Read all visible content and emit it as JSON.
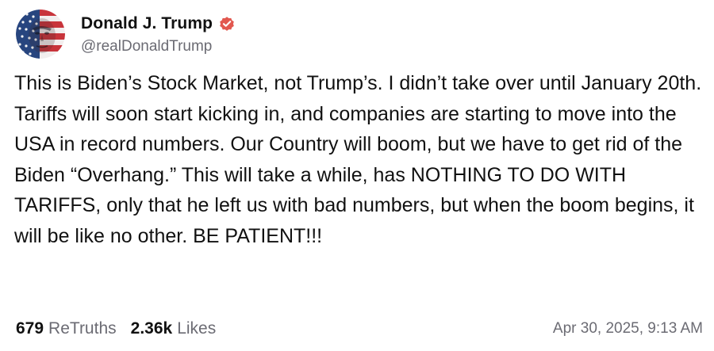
{
  "author": {
    "display_name": "Donald J. Trump",
    "handle": "@realDonaldTrump",
    "verified_icon": "verified-badge-icon",
    "verified_color": "#e2584f",
    "avatar_icon": "profile-avatar"
  },
  "post": {
    "text": "This is Biden’s Stock Market, not Trump’s. I didn’t take over until January 20th. Tariffs will soon start kicking in, and companies are starting to move into the USA in record numbers. Our Country will boom, but we have to get rid of the Biden “Overhang.” This will take a while, has NOTHING TO DO WITH TARIFFS, only that he left us with bad numbers, but when the boom begins, it will be like no other. BE PATIENT!!!"
  },
  "footer": {
    "retruths_count": "679",
    "retruths_label": "ReTruths",
    "likes_count": "2.36k",
    "likes_label": "Likes",
    "timestamp": "Apr 30, 2025, 9:13 AM"
  }
}
